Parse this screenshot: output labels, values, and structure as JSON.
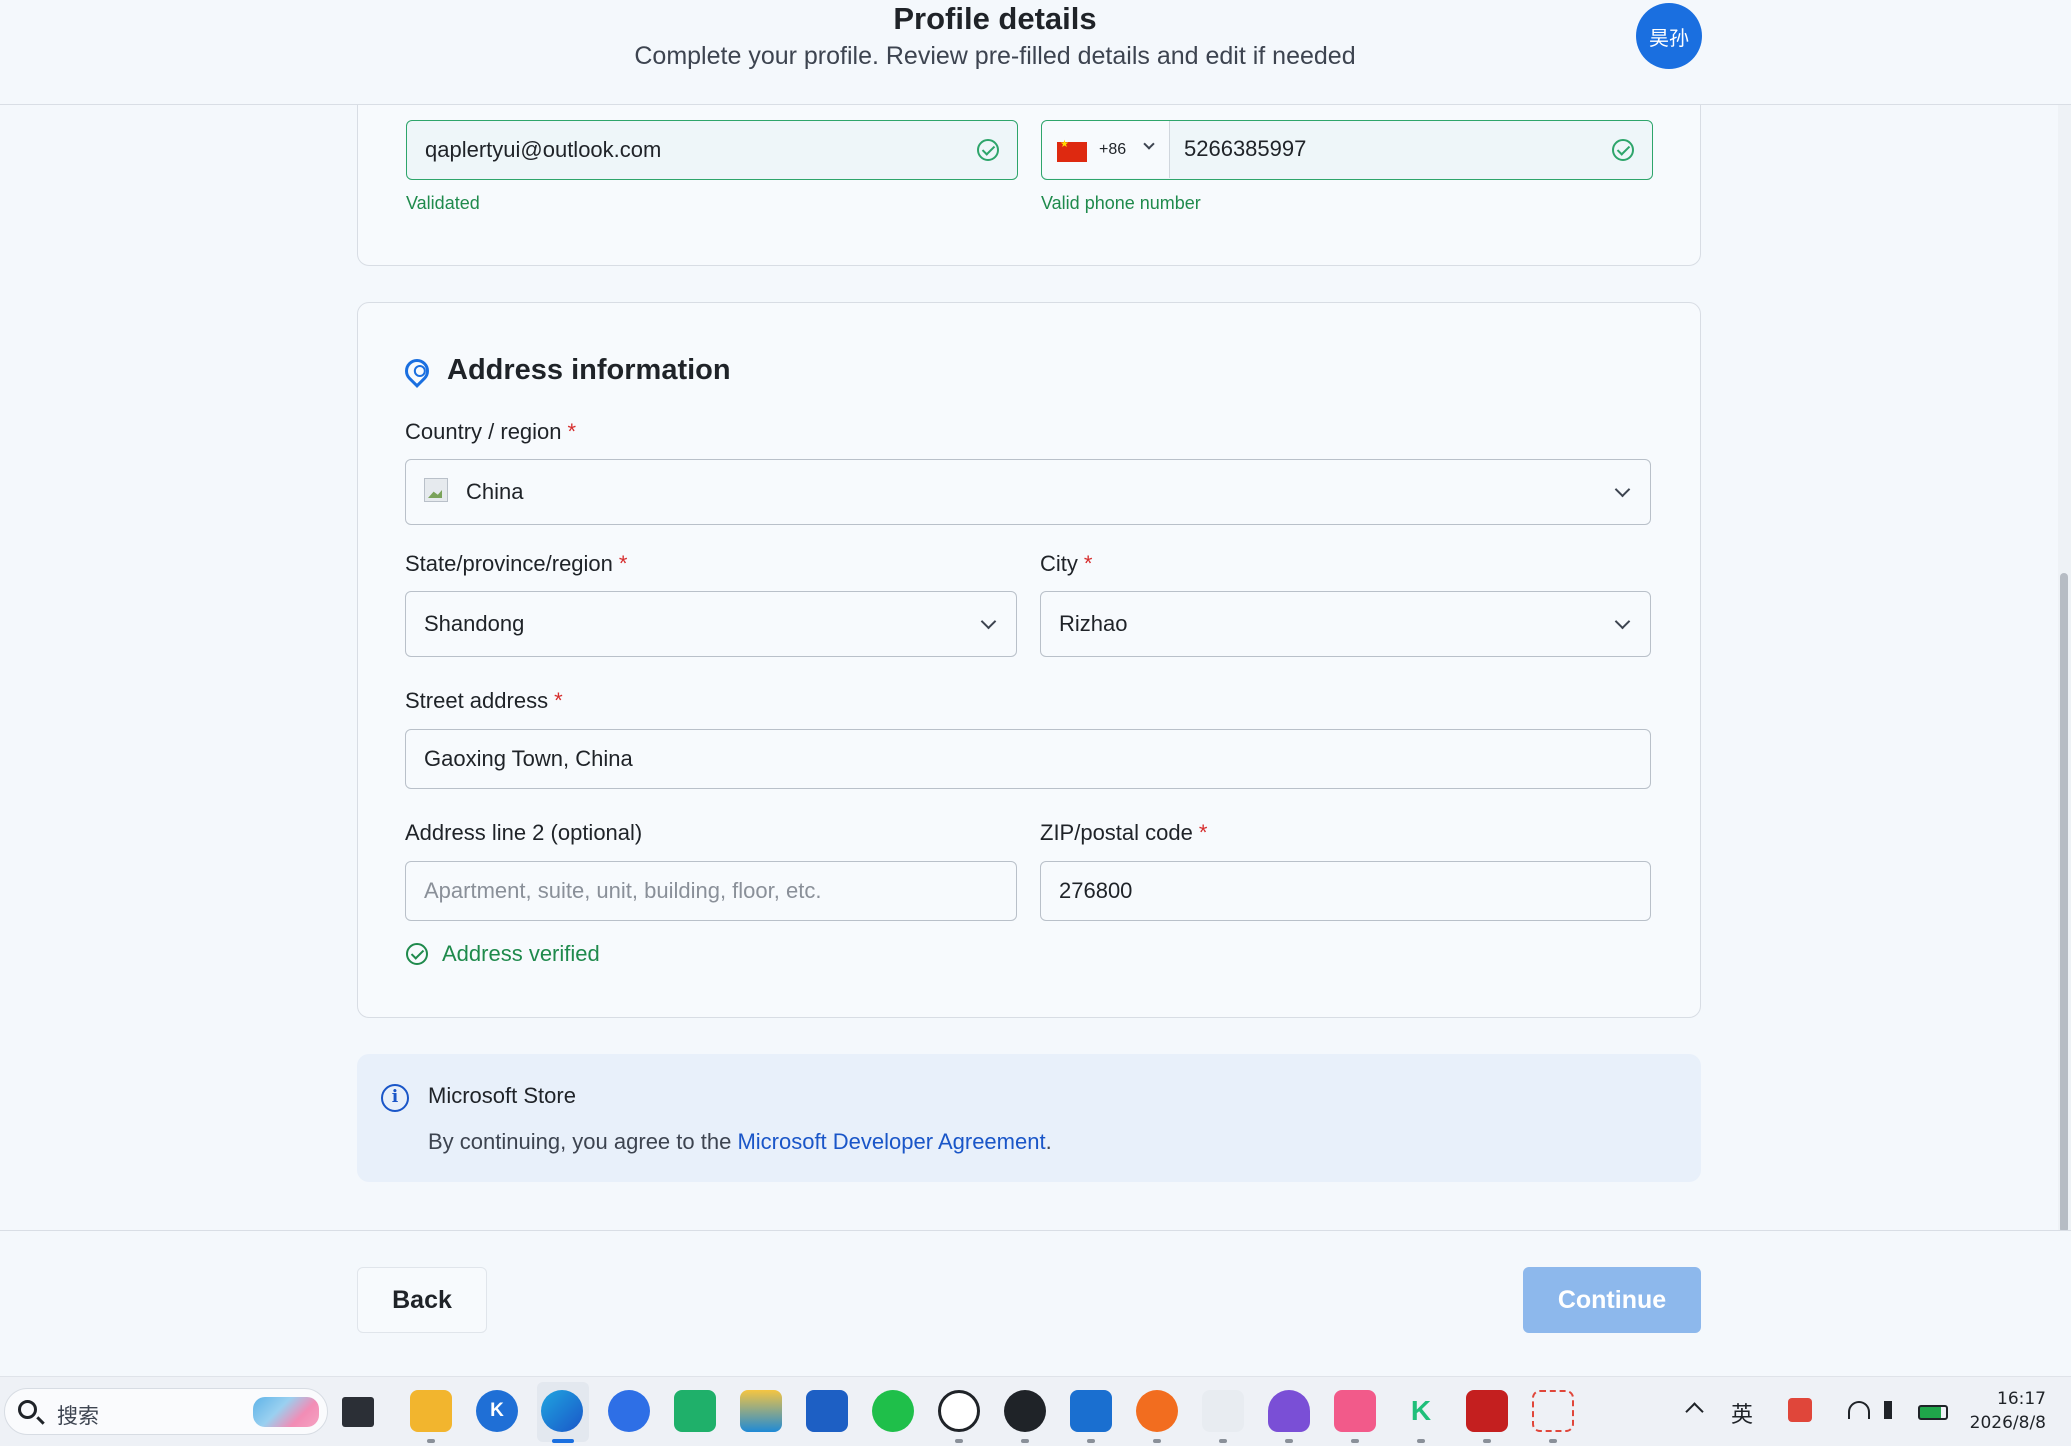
{
  "header": {
    "title": "Profile details",
    "subtitle": "Complete your profile. Review pre-filled details and edit if needed",
    "avatar_text": "昊孙"
  },
  "contact": {
    "email": "qaplertyui@outlook.com",
    "email_status": "Validated",
    "phone_prefix": "+86",
    "phone": "5266385997",
    "phone_status": "Valid phone number"
  },
  "address": {
    "section_title": "Address information",
    "country_label": "Country / region",
    "country_value": "China",
    "state_label": "State/province/region",
    "state_value": "Shandong",
    "city_label": "City",
    "city_value": "Rizhao",
    "street_label": "Street address",
    "street_value": "Gaoxing Town, China",
    "line2_label": "Address line 2 (optional)",
    "line2_placeholder": "Apartment, suite, unit, building, floor, etc.",
    "zip_label": "ZIP/postal code",
    "zip_value": "276800",
    "verified_text": "Address verified",
    "required_mark": "*"
  },
  "notice": {
    "title": "Microsoft Store",
    "text_prefix": "By continuing, you agree to the ",
    "link_text": "Microsoft Developer Agreement",
    "text_suffix": ".",
    "icon": "info-icon"
  },
  "footer": {
    "back_label": "Back",
    "continue_label": "Continue"
  },
  "taskbar": {
    "search_placeholder": "搜索",
    "tray_ime": "英",
    "time": "16:17",
    "date": "2026/8/8"
  },
  "colors": {
    "accent": "#1a6fe0",
    "valid_green": "#1f8a4c",
    "required_red": "#d62d2d",
    "continue_disabled": "#8db8ec"
  }
}
